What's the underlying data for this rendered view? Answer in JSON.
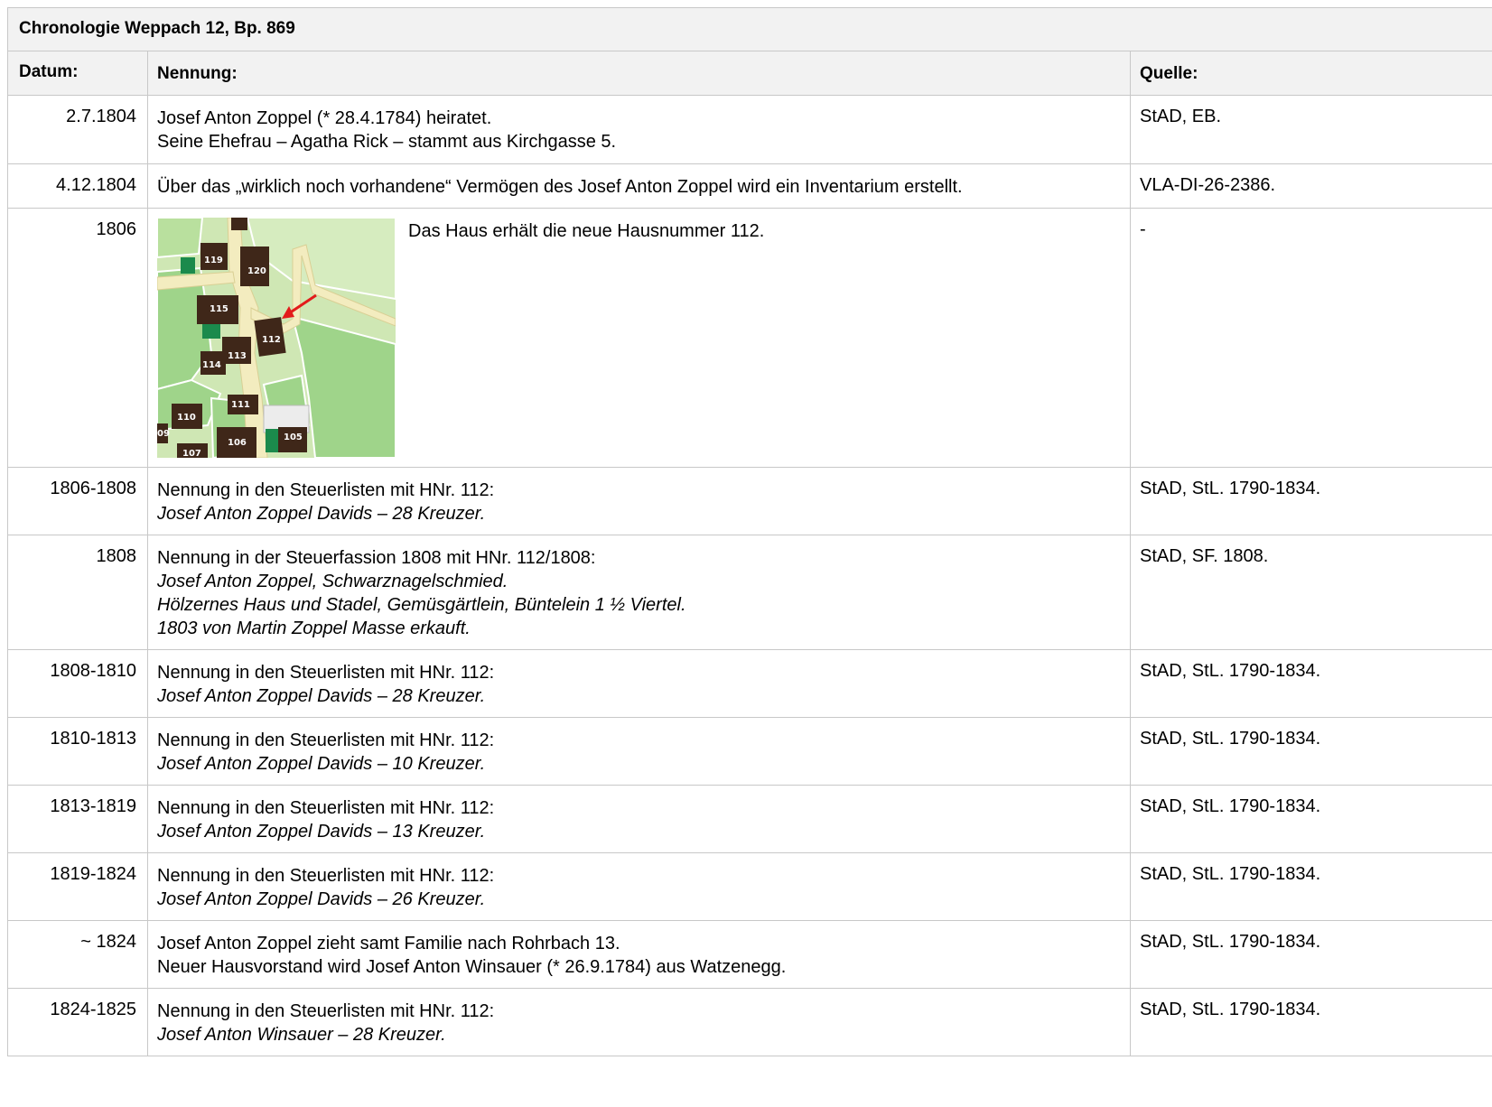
{
  "title": "Chronologie Weppach 12, Bp. 869",
  "headers": {
    "date": "Datum:",
    "mention": "Nennung:",
    "source": "Quelle:"
  },
  "map": {
    "house_labels": [
      "119",
      "120",
      "115",
      "112",
      "113",
      "114",
      "111",
      "110",
      "09",
      "106",
      "105",
      "107"
    ],
    "colors": {
      "meadow_light": "#cfe7b4",
      "meadow_dark": "#9fd48a",
      "road": "#f3ecbf",
      "house": "#3f2719",
      "garden": "#1b8a4c",
      "arrow": "#e31b1b"
    }
  },
  "rows": [
    {
      "date": "2.7.1804",
      "lines": [
        "Josef Anton Zoppel (* 28.4.1784) heiratet.",
        "Seine Ehefrau – Agatha Rick – stammt aus Kirchgasse 5."
      ],
      "source": "StAD, EB."
    },
    {
      "date": "4.12.1804",
      "lines": [
        "Über das „wirklich noch vorhandene“ Vermögen des Josef Anton Zoppel wird ein Inventarium erstellt."
      ],
      "source": "VLA-DI-26-2386."
    },
    {
      "date": "1806",
      "lines": [
        "Das  Haus erhält die neue Hausnummer 112."
      ],
      "source": "-"
    },
    {
      "date": "1806-1808",
      "lines": [
        "Nennung in den Steuerlisten mit HNr. 112:",
        "Josef Anton Zoppel Davids – 28 Kreuzer."
      ],
      "source": "StAD, StL. 1790-1834."
    },
    {
      "date": "1808",
      "lines": [
        "Nennung in der Steuerfassion 1808 mit HNr. 112/1808:",
        "Josef Anton Zoppel, Schwarznagelschmied.",
        "Hölzernes Haus und Stadel, Gemüsgärtlein, Büntelein 1 ½ Viertel.",
        "1803 von Martin Zoppel Masse erkauft."
      ],
      "source": "StAD, SF. 1808."
    },
    {
      "date": "1808-1810",
      "lines": [
        "Nennung in den Steuerlisten mit HNr. 112:",
        "Josef Anton Zoppel Davids – 28 Kreuzer."
      ],
      "source": "StAD, StL. 1790-1834."
    },
    {
      "date": "1810-1813",
      "lines": [
        "Nennung in den Steuerlisten mit HNr. 112:",
        "Josef Anton Zoppel Davids – 10 Kreuzer."
      ],
      "source": "StAD, StL. 1790-1834."
    },
    {
      "date": "1813-1819",
      "lines": [
        "Nennung in den Steuerlisten mit HNr. 112:",
        "Josef Anton Zoppel Davids – 13 Kreuzer."
      ],
      "source": "StAD, StL. 1790-1834."
    },
    {
      "date": "1819-1824",
      "lines": [
        "Nennung in den Steuerlisten mit HNr. 112:",
        "Josef Anton Zoppel Davids – 26 Kreuzer."
      ],
      "source": "StAD, StL. 1790-1834."
    },
    {
      "date": "~ 1824",
      "lines": [
        "Josef Anton Zoppel zieht samt Familie nach Rohrbach 13.",
        "Neuer Hausvorstand wird Josef Anton Winsauer (* 26.9.1784) aus Watzenegg."
      ],
      "source": "StAD, StL. 1790-1834."
    },
    {
      "date": "1824-1825",
      "lines": [
        "Nennung in den Steuerlisten mit HNr. 112:",
        "Josef Anton Winsauer – 28 Kreuzer."
      ],
      "source": "StAD, StL. 1790-1834."
    }
  ]
}
